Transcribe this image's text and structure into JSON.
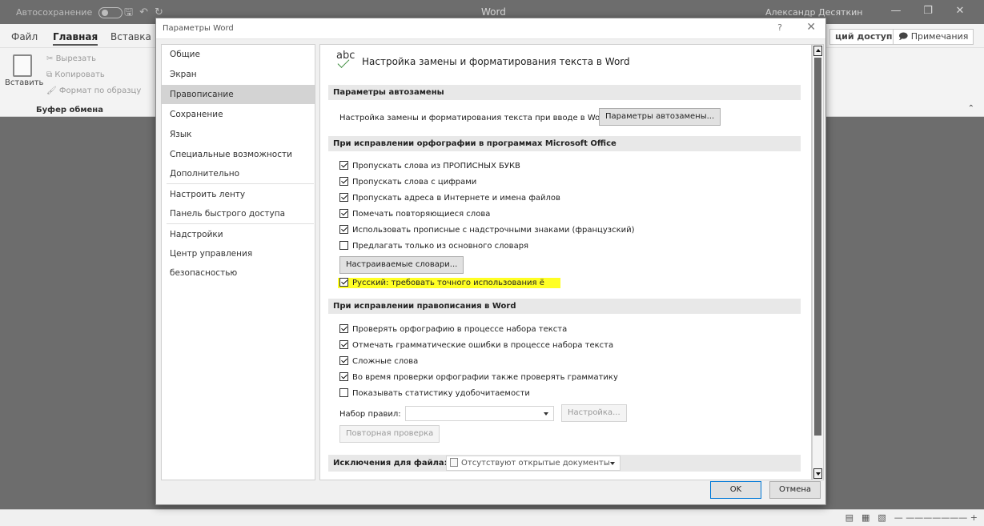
{
  "word": {
    "autosave_label": "Автосохранение",
    "title": "Word",
    "user": "Александр Десяткин",
    "tabs": [
      "Файл",
      "Главная",
      "Вставка"
    ],
    "share": "ций доступ",
    "comments": "Примечания",
    "ribbon": {
      "paste": "Вставить",
      "cut": "Вырезать",
      "copy": "Копировать",
      "format_painter": "Формат по образцу",
      "group": "Буфер обмена"
    }
  },
  "dialog": {
    "title": "Параметры Word",
    "help": "?",
    "close": "✕",
    "nav": [
      "Общие",
      "Экран",
      "Правописание",
      "Сохранение",
      "Язык",
      "Специальные возможности",
      "Дополнительно",
      "Настроить ленту",
      "Панель быстрого доступа",
      "Надстройки",
      "Центр управления безопасностью"
    ],
    "active_nav": "Правописание",
    "icon_text": "abc",
    "heading": "Настройка замены и форматирования текста в Word",
    "autocorrect": {
      "section": "Параметры автозамены",
      "label": "Настройка замены и форматирования текста при вводе в Word:",
      "button": "Параметры автозамены..."
    },
    "office_spelling": {
      "section": "При исправлении орфографии в программах Microsoft Office",
      "options": [
        {
          "label": "Пропускать слова из ПРОПИСНЫХ БУКВ",
          "checked": true
        },
        {
          "label": "Пропускать слова с цифрами",
          "checked": true
        },
        {
          "label": "Пропускать адреса в Интернете и имена файлов",
          "checked": true
        },
        {
          "label": "Помечать повторяющиеся слова",
          "checked": true
        },
        {
          "label": "Использовать прописные с надстрочными знаками (французский)",
          "checked": true
        },
        {
          "label": "Предлагать только из основного словаря",
          "checked": false
        }
      ],
      "dictionaries_button": "Настраиваемые словари...",
      "russian_option": {
        "label": "Русский: требовать точного использования ё",
        "checked": true
      }
    },
    "word_spelling": {
      "section": "При исправлении правописания в Word",
      "options": [
        {
          "label": "Проверять орфографию в процессе набора текста",
          "checked": true
        },
        {
          "label": "Отмечать грамматические ошибки в процессе набора текста",
          "checked": true
        },
        {
          "label": "Сложные слова",
          "checked": true
        },
        {
          "label": "Во время проверки орфографии также проверять грамматику",
          "checked": true
        },
        {
          "label": "Показывать статистику удобочитаемости",
          "checked": false
        }
      ],
      "ruleset_label": "Набор правил:",
      "ruleset_value": "",
      "settings_button": "Настройка...",
      "recheck_button": "Повторная проверка"
    },
    "exceptions": {
      "label": "Исключения для файла:",
      "value": "Отсутствуют открытые документы"
    },
    "ok": "OK",
    "cancel": "Отмена"
  },
  "colors": {
    "highlight": "#ffff24",
    "active_nav": "#d3d3d3",
    "ok_border": "#0078d7"
  }
}
